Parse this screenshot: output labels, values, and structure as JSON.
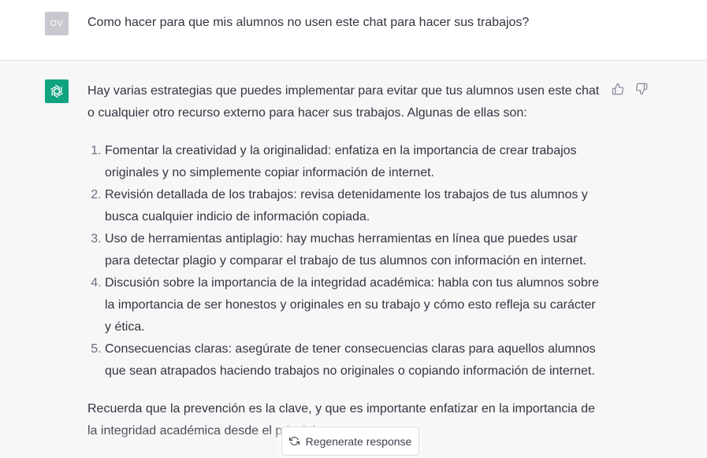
{
  "user": {
    "initials": "OV",
    "message": "Como hacer para que mis alumnos no usen este chat para hacer sus trabajos?"
  },
  "assistant": {
    "intro": "Hay varias estrategias que puedes implementar para evitar que tus alumnos usen este chat o cualquier otro recurso externo para hacer sus trabajos. Algunas de ellas son:",
    "items": [
      "Fomentar la creatividad y la originalidad: enfatiza en la importancia de crear trabajos originales y no simplemente copiar información de internet.",
      "Revisión detallada de los trabajos: revisa detenidamente los trabajos de tus alumnos y busca cualquier indicio de información copiada.",
      "Uso de herramientas antiplagio: hay muchas herramientas en línea que puedes usar para detectar plagio y comparar el trabajo de tus alumnos con información en internet.",
      "Discusión sobre la importancia de la integridad académica: habla con tus alumnos sobre la importancia de ser honestos y originales en su trabajo y cómo esto refleja su carácter y ética.",
      "Consecuencias claras: asegúrate de tener consecuencias claras para aquellos alumnos que sean atrapados haciendo trabajos no originales o copiando información de internet."
    ],
    "closing": "Recuerda que la prevención es la clave, y que es importante enfatizar en la importancia de la integridad académica desde el principio."
  },
  "regenerate": {
    "label": "Regenerate response"
  },
  "icons": {
    "bot_avatar": "openai-logo-icon",
    "thumbs_up": "thumbs-up-icon",
    "thumbs_down": "thumbs-down-icon",
    "regenerate": "refresh-icon"
  },
  "colors": {
    "accent": "#10a37f",
    "bot_background": "#f7f7f8",
    "user_avatar": "#c8c9cf"
  }
}
